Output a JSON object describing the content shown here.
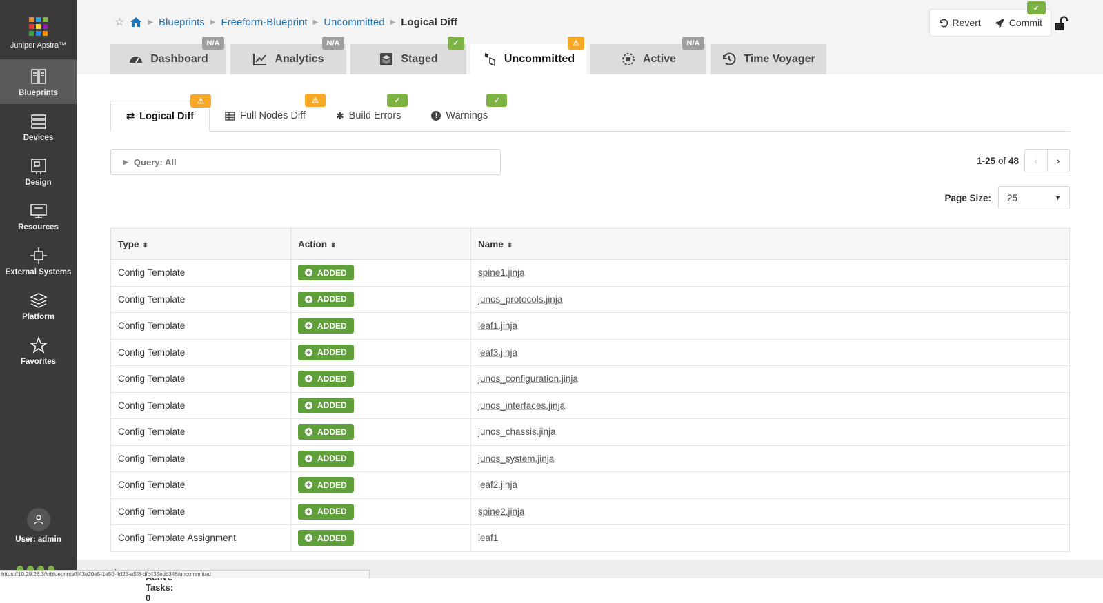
{
  "app": {
    "brand": "Juniper Apstra™"
  },
  "sidebar": {
    "items": [
      {
        "label": "Blueprints",
        "icon": "blueprints-icon"
      },
      {
        "label": "Devices",
        "icon": "devices-icon"
      },
      {
        "label": "Design",
        "icon": "design-icon"
      },
      {
        "label": "Resources",
        "icon": "resources-icon"
      },
      {
        "label": "External Systems",
        "icon": "external-systems-icon"
      },
      {
        "label": "Platform",
        "icon": "platform-icon"
      },
      {
        "label": "Favorites",
        "icon": "star-icon"
      }
    ],
    "user": "User: admin"
  },
  "breadcrumb": [
    "Blueprints",
    "Freeform-Blueprint",
    "Uncommitted",
    "Logical Diff"
  ],
  "actions": {
    "revert": "Revert",
    "commit": "Commit",
    "commit_badge": "ok"
  },
  "tabs": [
    {
      "label": "Dashboard",
      "badge": "N/A"
    },
    {
      "label": "Analytics",
      "badge": "N/A"
    },
    {
      "label": "Staged",
      "badge": "ok"
    },
    {
      "label": "Uncommitted",
      "badge": "warning"
    },
    {
      "label": "Active",
      "badge": "N/A"
    },
    {
      "label": "Time Voyager",
      "badge": ""
    }
  ],
  "subtabs": [
    {
      "label": "Logical Diff",
      "badge": "warning"
    },
    {
      "label": "Full Nodes Diff",
      "badge": "warning"
    },
    {
      "label": "Build Errors",
      "badge": "ok"
    },
    {
      "label": "Warnings",
      "badge": "ok"
    }
  ],
  "query": {
    "label": "Query: All"
  },
  "pager": {
    "range": "1-25",
    "of": "of",
    "total": "48"
  },
  "page_size": {
    "label": "Page Size:",
    "value": "25"
  },
  "table": {
    "headers": [
      "Type",
      "Action",
      "Name"
    ],
    "rows": [
      {
        "type": "Config Template",
        "action": "ADDED",
        "name": "spine1.jinja"
      },
      {
        "type": "Config Template",
        "action": "ADDED",
        "name": "junos_protocols.jinja"
      },
      {
        "type": "Config Template",
        "action": "ADDED",
        "name": "leaf1.jinja"
      },
      {
        "type": "Config Template",
        "action": "ADDED",
        "name": "leaf3.jinja"
      },
      {
        "type": "Config Template",
        "action": "ADDED",
        "name": "junos_configuration.jinja"
      },
      {
        "type": "Config Template",
        "action": "ADDED",
        "name": "junos_interfaces.jinja"
      },
      {
        "type": "Config Template",
        "action": "ADDED",
        "name": "junos_chassis.jinja"
      },
      {
        "type": "Config Template",
        "action": "ADDED",
        "name": "junos_system.jinja"
      },
      {
        "type": "Config Template",
        "action": "ADDED",
        "name": "leaf2.jinja"
      },
      {
        "type": "Config Template",
        "action": "ADDED",
        "name": "spine2.jinja"
      },
      {
        "type": "Config Template Assignment",
        "action": "ADDED",
        "name": "leaf1"
      }
    ]
  },
  "bottom": {
    "tasks": "Active Tasks: 0"
  },
  "status_url": "https://10.29.26.3/#/blueprints/543e20e5-1e50-4d23-a5f8-dfc435edb346/uncommitted",
  "colors": {
    "added": "#5fa03b",
    "ok": "#7cb342",
    "warning": "#f9a825",
    "na": "#9e9e9e",
    "link": "#1f73b7",
    "sidebar": "#3a3a3a"
  }
}
